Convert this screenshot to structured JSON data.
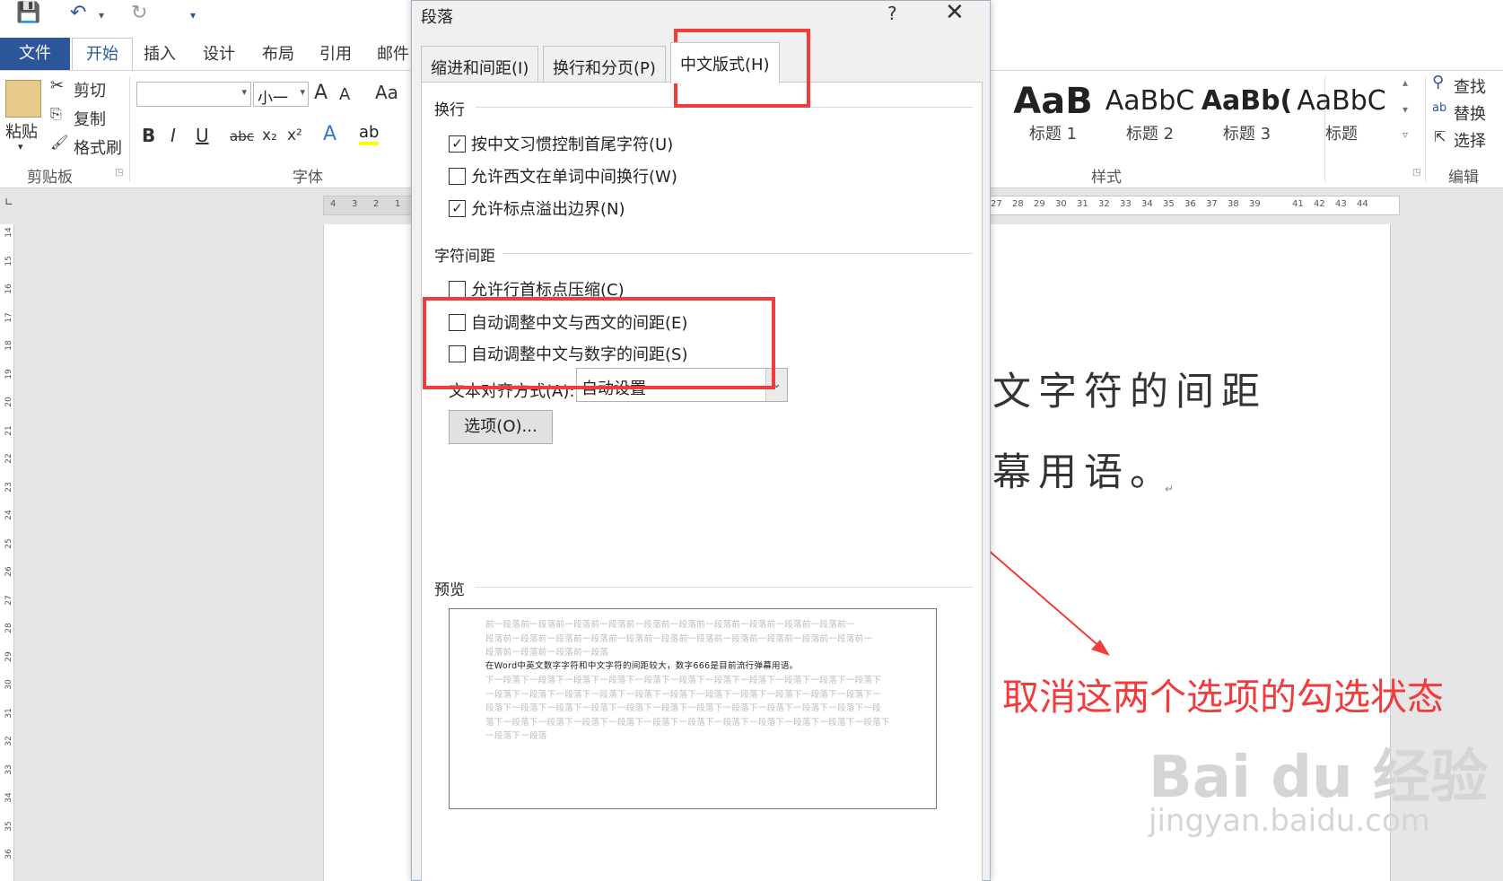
{
  "qat": {
    "save_icon": "save-icon",
    "undo_icon": "undo-icon",
    "redo_icon": "redo-icon",
    "customize_icon": "customize-qat-icon"
  },
  "tabs": {
    "file": "文件",
    "home": "开始",
    "insert": "插入",
    "design": "设计",
    "layout": "布局",
    "references": "引用",
    "mailings": "邮件"
  },
  "clipboard": {
    "paste": "粘贴",
    "cut": "剪切",
    "copy": "复制",
    "format_painter": "格式刷",
    "group": "剪贴板"
  },
  "font": {
    "size": "小一",
    "group": "字体",
    "bold": "B",
    "italic": "I",
    "underline": "U",
    "strike": "abc",
    "grow": "A",
    "shrink": "A",
    "case": "Aa"
  },
  "styles": {
    "items": [
      {
        "preview": "AaB",
        "name": "标题 1"
      },
      {
        "preview": "AaBbC",
        "name": "标题 2"
      },
      {
        "preview": "AaBb(",
        "name": "标题 3"
      },
      {
        "preview": "AaBbC",
        "name": "标题"
      }
    ],
    "group": "样式"
  },
  "editing": {
    "find": "查找",
    "replace": "替换",
    "select": "选择",
    "group": "编辑"
  },
  "ruler": {
    "left": [
      "4",
      "3",
      "2",
      "1"
    ],
    "right": [
      "27",
      "28",
      "29",
      "30",
      "31",
      "32",
      "33",
      "34",
      "35",
      "36",
      "37",
      "38",
      "39",
      "41",
      "42",
      "43",
      "44"
    ]
  },
  "vruler": [
    "14",
    "15",
    "16",
    "17",
    "18",
    "19",
    "20",
    "21",
    "22",
    "23",
    "24",
    "25",
    "26",
    "27",
    "28",
    "29",
    "30",
    "31",
    "32",
    "33",
    "34",
    "35",
    "36"
  ],
  "document": {
    "line1": "文字符的间距",
    "line2": "幕用语。"
  },
  "dialog": {
    "title": "段落",
    "help": "?",
    "close": "✕",
    "tabs": [
      "缩进和间距(I)",
      "换行和分页(P)",
      "中文版式(H)"
    ],
    "section_wrap": "换行",
    "wrap_options": [
      {
        "label": "按中文习惯控制首尾字符(U)",
        "checked": "✓"
      },
      {
        "label": "允许西文在单词中间换行(W)",
        "checked": ""
      },
      {
        "label": "允许标点溢出边界(N)",
        "checked": "✓"
      }
    ],
    "section_spacing": "字符间距",
    "spacing_options": [
      {
        "label": "允许行首标点压缩(C)",
        "checked": ""
      },
      {
        "label": "自动调整中文与西文的间距(E)",
        "checked": ""
      },
      {
        "label": "自动调整中文与数字的间距(S)",
        "checked": ""
      }
    ],
    "align_label": "文本对齐方式(A):",
    "align_value": "自动设置",
    "options_btn": "选项(O)...",
    "section_preview": "预览",
    "preview_before": [
      "前一段落前一段落前一段落前一段落前一段落前一段落前一段落前一段落前一段落前一段落前一",
      "段落前一段落前一段落前一段落前一段落前一段落前一段落前一段落前一段落前一段落前一段落前一",
      "段落前一段落前一段落前一段落"
    ],
    "preview_main": "在Word中英文数字字符和中文字符的间距较大，数字666是目前流行弹幕用语。",
    "preview_after": [
      "下一段落下一段落下一段落下一段落下一段落下一段落下一段落下一段落下一段落下一段落下一段落下",
      "一段落下一段落下一段落下一段落下一段落下一段落下一段落下一段落下一段落下一段落下一段落下一",
      "段落下一段落下一段落下一段落下一段落下一段落下一段落下一段落下一段落下一段落下一段落下一段",
      "落下一段落下一段落下一段落下一段落下一段落下一段落下一段落下一段落下一段落下一段落下一段落下",
      "一段落下一段落"
    ]
  },
  "annotation": "取消这两个选项的勾选状态",
  "watermark": {
    "brand": "Bai du 经验",
    "url": "jingyan.baidu.com"
  },
  "colors": {
    "accent": "#2b579a",
    "annotation": "#f03c3c"
  }
}
